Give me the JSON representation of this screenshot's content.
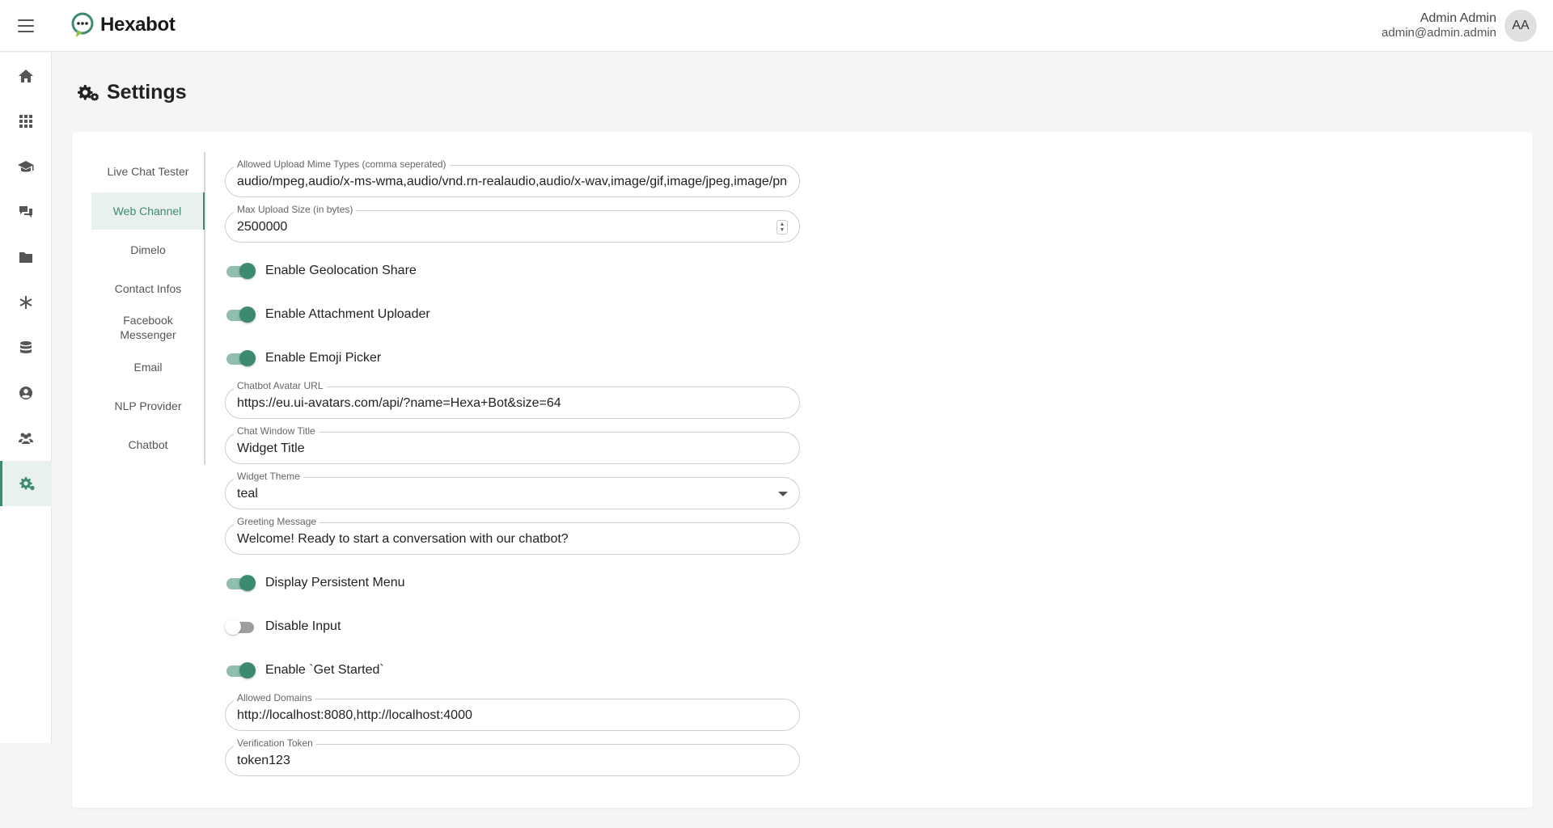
{
  "header": {
    "brand": "Hexabot",
    "user_name": "Admin Admin",
    "user_email": "admin@admin.admin",
    "avatar_initials": "AA",
    "accent_color": "#3d8a73"
  },
  "sidebar": {
    "items": [
      {
        "icon": "home-icon"
      },
      {
        "icon": "apps-grid-icon"
      },
      {
        "icon": "graduation-cap-icon"
      },
      {
        "icon": "chat-bubbles-icon"
      },
      {
        "icon": "folder-icon"
      },
      {
        "icon": "asterisk-icon"
      },
      {
        "icon": "database-icon"
      },
      {
        "icon": "user-circle-icon"
      },
      {
        "icon": "users-group-icon"
      },
      {
        "icon": "gears-icon",
        "active": true
      }
    ]
  },
  "page": {
    "title": "Settings",
    "title_icon": "gears-icon"
  },
  "tabs": [
    {
      "label": "Live Chat Tester"
    },
    {
      "label": "Web Channel",
      "active": true
    },
    {
      "label": "Dimelo"
    },
    {
      "label": "Contact Infos"
    },
    {
      "label": "Facebook Messenger"
    },
    {
      "label": "Email"
    },
    {
      "label": "NLP Provider"
    },
    {
      "label": "Chatbot"
    }
  ],
  "form": {
    "mime_types": {
      "label": "Allowed Upload Mime Types (comma seperated)",
      "value": "audio/mpeg,audio/x-ms-wma,audio/vnd.rn-realaudio,audio/x-wav,image/gif,image/jpeg,image/png"
    },
    "max_upload": {
      "label": "Max Upload Size (in bytes)",
      "value": "2500000"
    },
    "geolocation": {
      "label": "Enable Geolocation Share",
      "on": true
    },
    "attachment": {
      "label": "Enable Attachment Uploader",
      "on": true
    },
    "emoji": {
      "label": "Enable Emoji Picker",
      "on": true
    },
    "avatar_url": {
      "label": "Chatbot Avatar URL",
      "value": "https://eu.ui-avatars.com/api/?name=Hexa+Bot&size=64"
    },
    "window_title": {
      "label": "Chat Window Title",
      "value": "Widget Title"
    },
    "theme": {
      "label": "Widget Theme",
      "value": "teal"
    },
    "greeting": {
      "label": "Greeting Message",
      "value": "Welcome! Ready to start a conversation with our chatbot?"
    },
    "persistent_menu": {
      "label": "Display Persistent Menu",
      "on": true
    },
    "disable_input": {
      "label": "Disable Input",
      "on": false
    },
    "get_started": {
      "label": "Enable `Get Started`",
      "on": true
    },
    "allowed_domains": {
      "label": "Allowed Domains",
      "value": "http://localhost:8080,http://localhost:4000"
    },
    "verification_token": {
      "label": "Verification Token",
      "value": "token123"
    }
  }
}
